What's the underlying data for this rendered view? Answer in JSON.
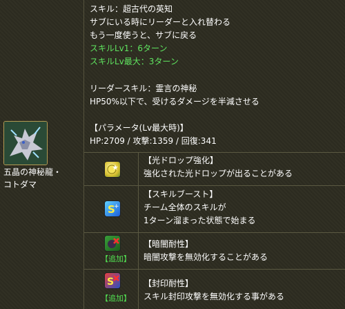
{
  "skill": {
    "name": "スキル：超古代の英知",
    "desc1": "サブにいる時にリーダーと入れ替わる",
    "desc2": "もう一度使うと、サブに戻る",
    "lv1": "スキルLv1：6ターン",
    "lvmax": "スキルLv最大：3ターン"
  },
  "leader": {
    "name": "リーダースキル：霊言の神秘",
    "desc": "HP50%以下で、受けるダメージを半減させる"
  },
  "params": {
    "title": "【パラメータ(Lv最大時)】",
    "stats": "HP:2709 / 攻撃:1359 / 回復:341"
  },
  "monster": {
    "name_line1": "五晶の神秘龍・",
    "name_line2": "コトダマ"
  },
  "awakenings": [
    {
      "icon": "light-drop-enhance-icon",
      "title": "【光ドロップ強化】",
      "line1": "強化された光ドロップが出ることがある",
      "line2": "",
      "tag": ""
    },
    {
      "icon": "skill-boost-icon",
      "title": "【スキルブースト】",
      "line1": "チーム全体のスキルが",
      "line2": "1ターン溜まった状態で始まる",
      "tag": ""
    },
    {
      "icon": "dark-resist-icon",
      "title": "【暗闇耐性】",
      "line1": "暗闇攻撃を無効化することがある",
      "line2": "",
      "tag": "【追加】"
    },
    {
      "icon": "bind-resist-icon",
      "title": "【封印耐性】",
      "line1": "スキル封印攻撃を無効化する事がある",
      "line2": "",
      "tag": "【追加】"
    }
  ],
  "colors": {
    "text": "#ffffff",
    "green": "#5fe35f",
    "background": "#2f2e22",
    "border": "#5b5942"
  }
}
